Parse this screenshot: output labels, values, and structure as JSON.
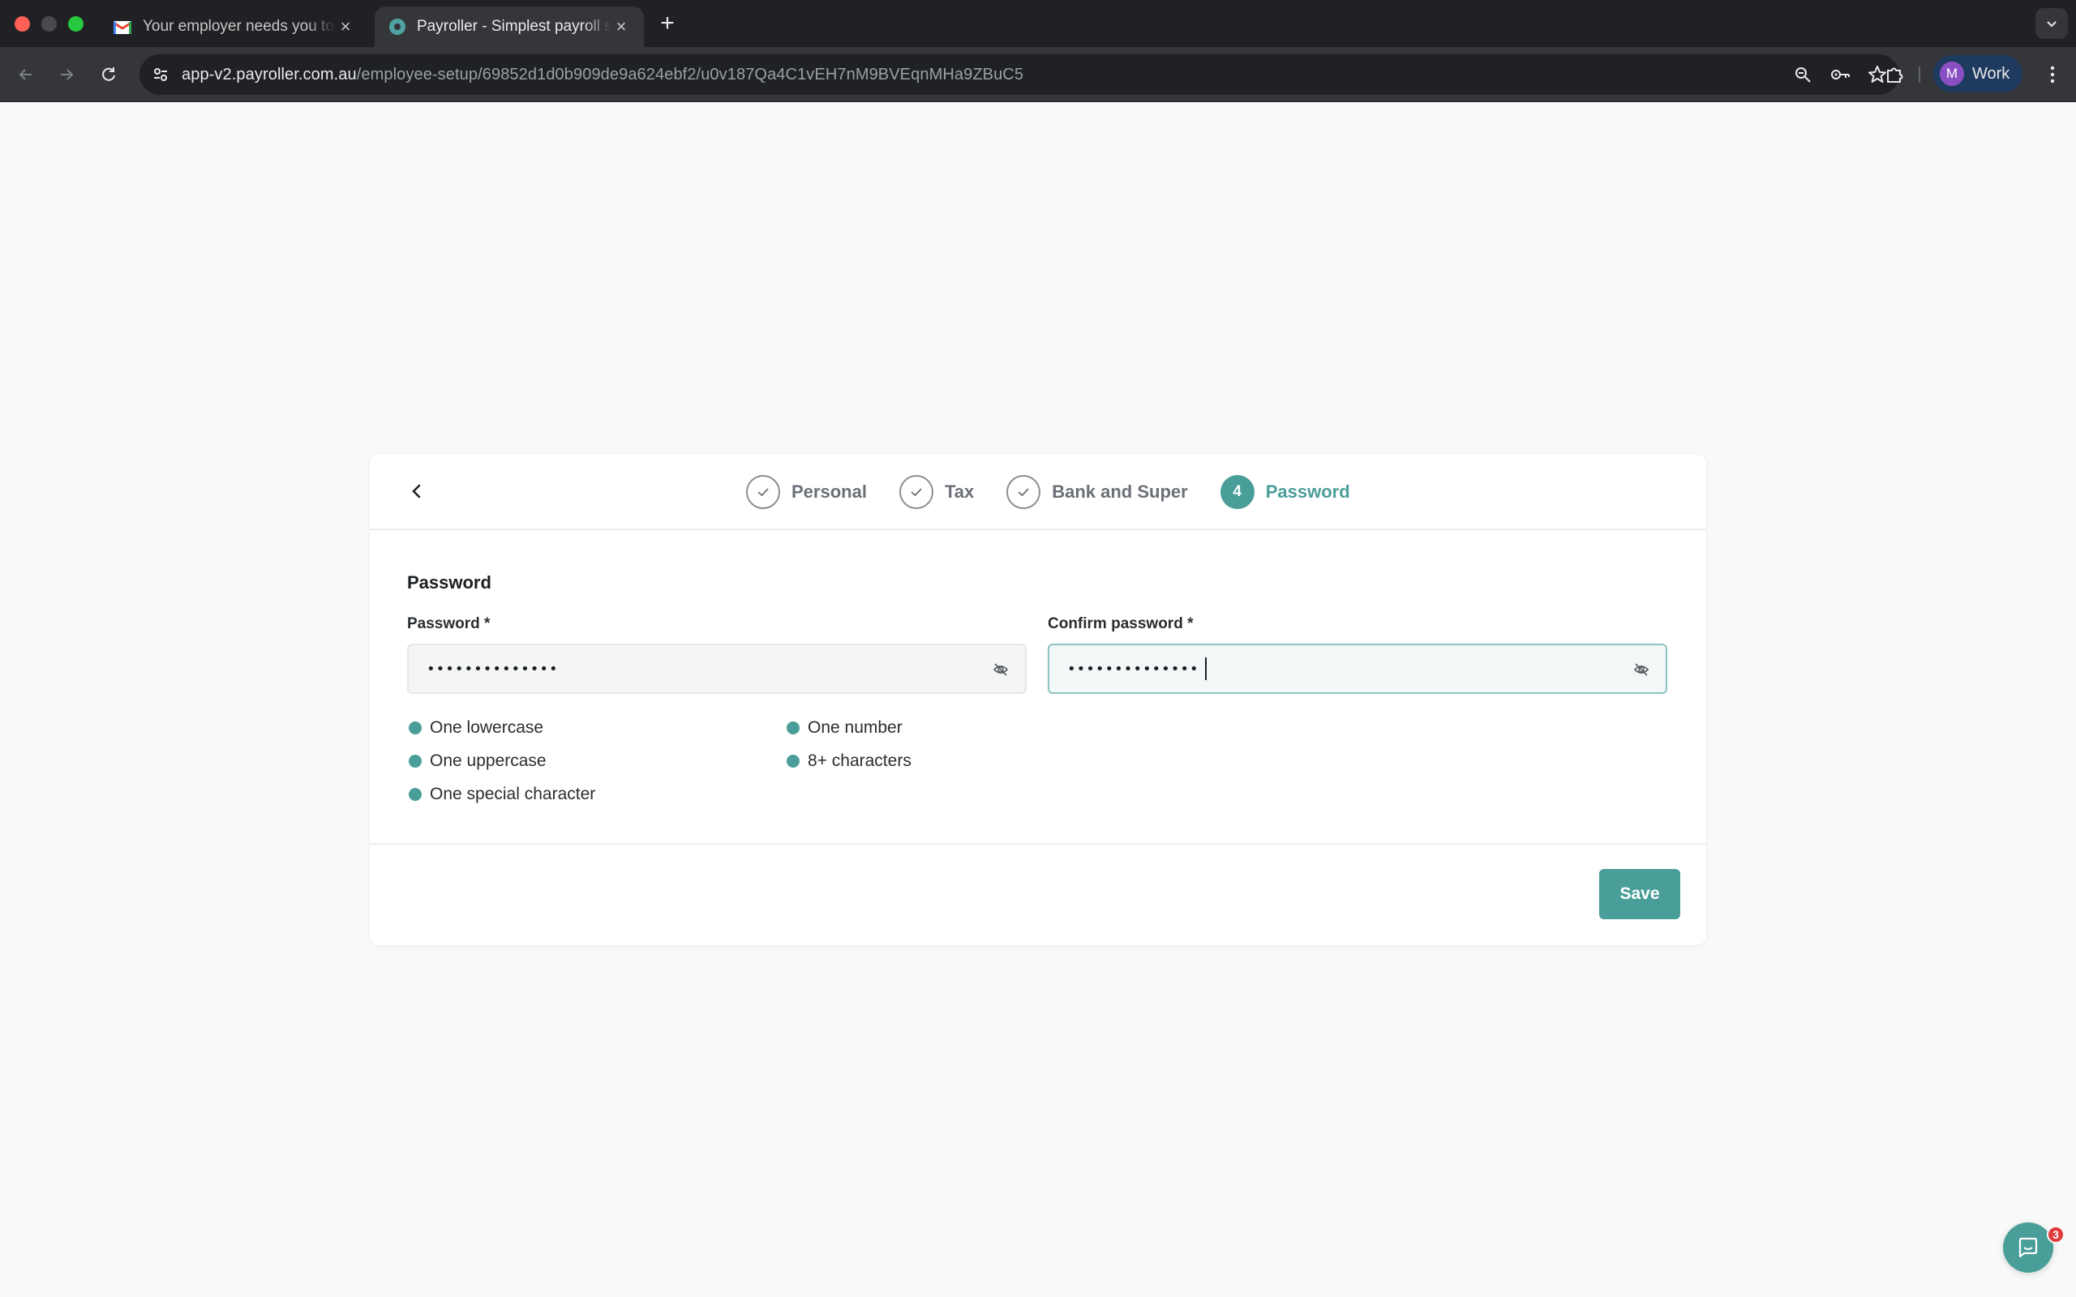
{
  "browser": {
    "tabs": [
      {
        "title": "Your employer needs you to fill",
        "favicon": "gmail-icon",
        "active": false
      },
      {
        "title": "Payroller - Simplest payroll software",
        "favicon": "payroller-icon",
        "active": true
      }
    ],
    "url_host": "app-v2.payroller.com.au",
    "url_path": "/employee-setup/69852d1d0b909de9a624ebf2/u0v187Qa4C1vEH7nM9BVEqnMHa9ZBuC5",
    "profile_initial": "M",
    "profile_name": "Work",
    "colors": {
      "tabstrip": "#202124",
      "toolbar": "#35363a",
      "profile_avatar": "#8b4fc4"
    }
  },
  "stepper": {
    "steps": [
      {
        "label": "Personal",
        "state": "complete",
        "icon": "check-icon"
      },
      {
        "label": "Tax",
        "state": "complete",
        "icon": "check-icon"
      },
      {
        "label": "Bank and Super",
        "state": "complete",
        "icon": "check-icon"
      },
      {
        "label": "Password",
        "state": "active",
        "number": "4"
      }
    ]
  },
  "form": {
    "section_title": "Password",
    "password": {
      "label": "Password *",
      "value": "••••••••••••••",
      "visibility_icon": "eye-off-icon"
    },
    "confirm_password": {
      "label": "Confirm password *",
      "value": "••••••••••••••",
      "visibility_icon": "eye-off-icon"
    },
    "requirements": [
      {
        "label": "One lowercase",
        "met": true
      },
      {
        "label": "One uppercase",
        "met": true
      },
      {
        "label": "One special character",
        "met": true
      },
      {
        "label": "One number",
        "met": true
      },
      {
        "label": "8+ characters",
        "met": true
      }
    ],
    "save_label": "Save"
  },
  "chat": {
    "unread_count": "3"
  },
  "colors": {
    "accent": "#4a9e99",
    "page_background": "#f8f9f9",
    "card": "#ffffff",
    "badge": "#e03a3a"
  }
}
